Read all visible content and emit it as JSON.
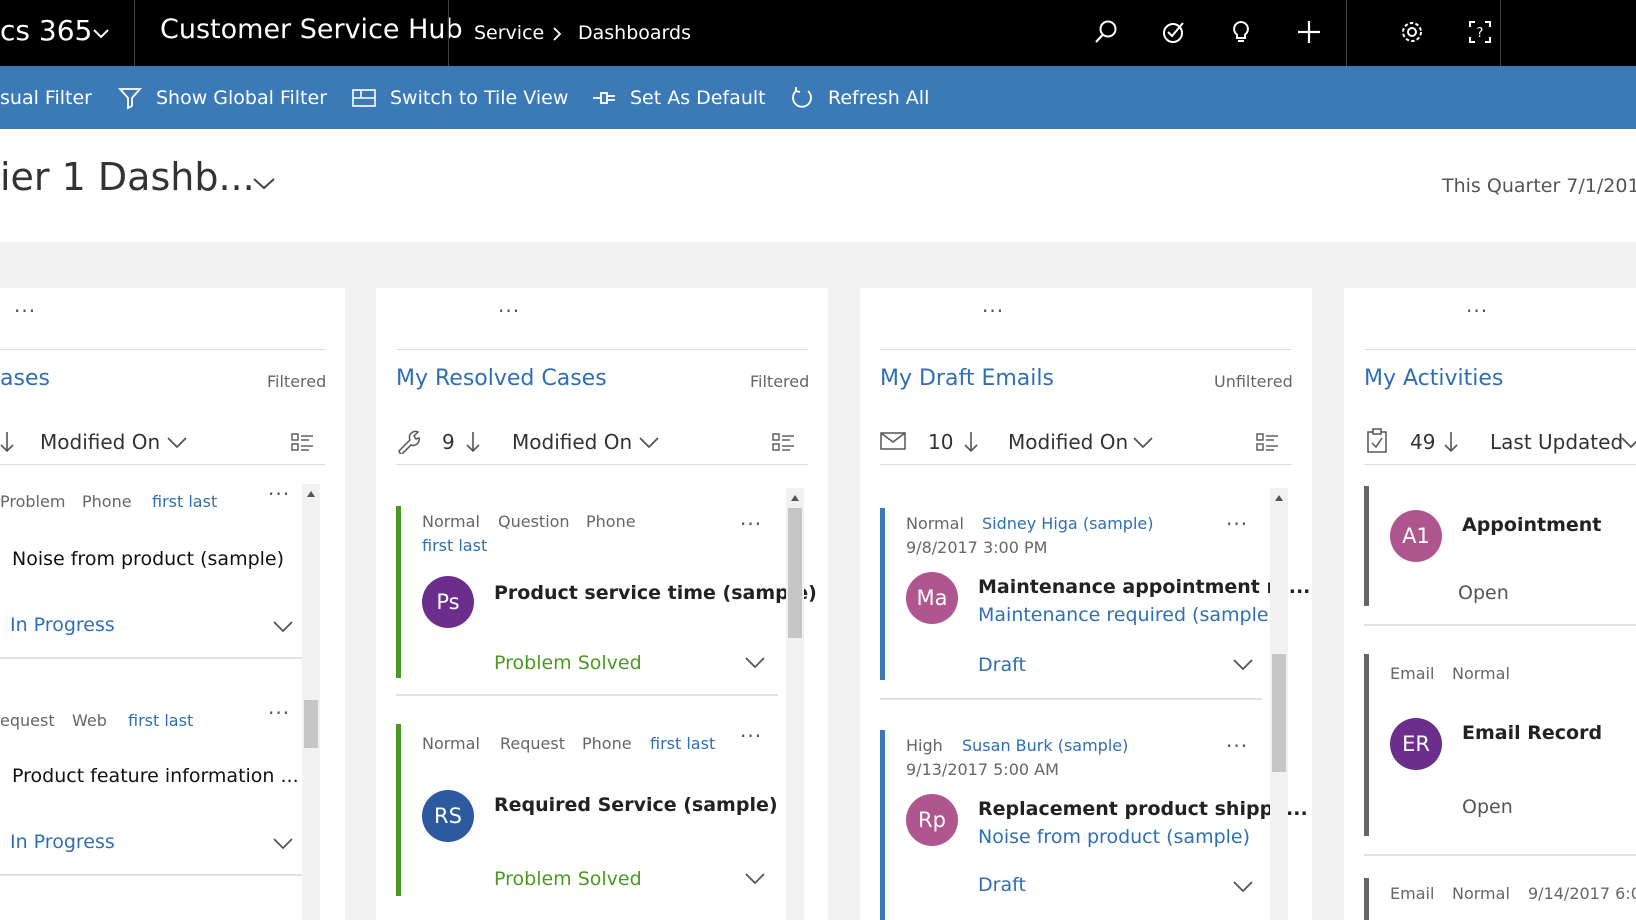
{
  "topbar": {
    "app_suffix": "cs 365",
    "app_name": "Customer Service Hub",
    "breadcrumb_area": "Service",
    "breadcrumb_page": "Dashboards"
  },
  "commands": [
    {
      "label": "sual Filter"
    },
    {
      "label": "Show Global Filter"
    },
    {
      "label": "Switch to Tile View"
    },
    {
      "label": "Set As Default"
    },
    {
      "label": "Refresh All"
    }
  ],
  "header": {
    "dashboard_title": "ier 1 Dashb...",
    "timeframe": "This Quarter 7/1/201"
  },
  "dots": "...",
  "cards": {
    "active": {
      "title": "ases",
      "filter": "Filtered",
      "sort_field": "Modified On",
      "items": [
        {
          "meta1": "Problem",
          "meta2": "Phone",
          "owner": "first last",
          "title": "Noise from product (sample)",
          "status": "In Progress"
        },
        {
          "meta1": "equest",
          "meta2": "Web",
          "owner": "first last",
          "title": "Product feature information ...",
          "status": "In Progress"
        }
      ]
    },
    "resolved": {
      "title": "My Resolved Cases",
      "filter": "Filtered",
      "count": "9",
      "sort_field": "Modified On",
      "items": [
        {
          "priority": "Normal",
          "type": "Question",
          "origin": "Phone",
          "owner": "first last",
          "initials": "Ps",
          "title": "Product service time (sample)",
          "status": "Problem Solved"
        },
        {
          "priority": "Normal",
          "type": "Request",
          "origin": "Phone",
          "owner": "first last",
          "initials": "RS",
          "title": "Required Service (sample)",
          "status": "Problem Solved"
        }
      ]
    },
    "drafts": {
      "title": "My Draft Emails",
      "filter": "Unfiltered",
      "count": "10",
      "sort_field": "Modified On",
      "items": [
        {
          "priority": "Normal",
          "from": "Sidney Higa (sample)",
          "date": "9/8/2017 3:00 PM",
          "initials": "Ma",
          "title": "Maintenance appointment re...",
          "regarding": "Maintenance required (sample)",
          "status": "Draft"
        },
        {
          "priority": "High",
          "from": "Susan Burk (sample)",
          "date": "9/13/2017 5:00 AM",
          "initials": "Rp",
          "title": "Replacement product shippe...",
          "regarding": "Noise from product (sample)",
          "status": "Draft"
        }
      ]
    },
    "activities": {
      "title": "My Activities",
      "count": "49",
      "sort_field": "Last Updated",
      "items": [
        {
          "initials": "A1",
          "title": "Appointment",
          "status": "Open"
        },
        {
          "type": "Email",
          "priority": "Normal",
          "initials": "ER",
          "title": "Email Record",
          "status": "Open"
        },
        {
          "type": "Email",
          "priority": "Normal",
          "date": "9/14/2017 6:0"
        }
      ]
    }
  },
  "colors": {
    "topbar": "#000000",
    "command_bar": "#3b79b7",
    "link": "#2f6fb3",
    "resolved_bar": "#4a9a22",
    "status_green": "#4a9a22",
    "email_bar": "#3b79b7",
    "activity_bar": "#666666",
    "avatar_purple": "#6b2e8c",
    "avatar_blue": "#2d5a9e",
    "avatar_pink": "#b0568f"
  }
}
